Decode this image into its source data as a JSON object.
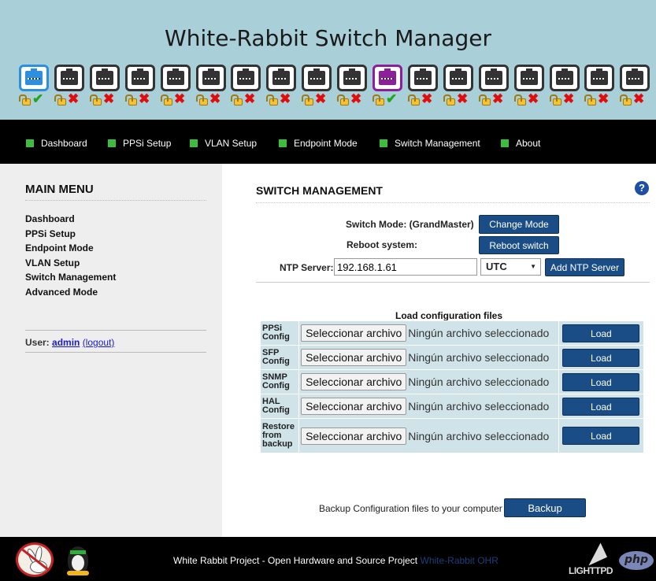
{
  "header": {
    "title": "White-Rabbit Switch Manager"
  },
  "ports": [
    {
      "name": "wr1",
      "color": "#2d8fe0",
      "locked": true,
      "link_ok": true
    },
    {
      "name": "wr2",
      "color": "#333333",
      "locked": false,
      "link_ok": false
    },
    {
      "name": "wr3",
      "color": "#333333",
      "locked": false,
      "link_ok": false
    },
    {
      "name": "wr4",
      "color": "#333333",
      "locked": false,
      "link_ok": false
    },
    {
      "name": "wr5",
      "color": "#333333",
      "locked": false,
      "link_ok": false
    },
    {
      "name": "wr6",
      "color": "#333333",
      "locked": false,
      "link_ok": false
    },
    {
      "name": "wr7",
      "color": "#333333",
      "locked": false,
      "link_ok": false
    },
    {
      "name": "wr8",
      "color": "#333333",
      "locked": false,
      "link_ok": false
    },
    {
      "name": "wr9",
      "color": "#333333",
      "locked": false,
      "link_ok": false
    },
    {
      "name": "wr10",
      "color": "#333333",
      "locked": false,
      "link_ok": false
    },
    {
      "name": "wr11",
      "color": "#8d1f9a",
      "locked": false,
      "link_ok": true
    },
    {
      "name": "wr12",
      "color": "#333333",
      "locked": false,
      "link_ok": false
    },
    {
      "name": "wr13",
      "color": "#333333",
      "locked": false,
      "link_ok": false
    },
    {
      "name": "wr14",
      "color": "#333333",
      "locked": false,
      "link_ok": false
    },
    {
      "name": "wr15",
      "color": "#333333",
      "locked": false,
      "link_ok": false
    },
    {
      "name": "wr16",
      "color": "#333333",
      "locked": false,
      "link_ok": false
    },
    {
      "name": "wr17",
      "color": "#333333",
      "locked": false,
      "link_ok": false
    },
    {
      "name": "wr18",
      "color": "#333333",
      "locked": false,
      "link_ok": false
    }
  ],
  "nav": {
    "items": [
      {
        "label": "Dashboard"
      },
      {
        "label": "PPSi Setup"
      },
      {
        "label": "VLAN Setup"
      },
      {
        "label": "Endpoint Mode"
      },
      {
        "label": "Switch Management"
      },
      {
        "label": "About"
      }
    ]
  },
  "sidebar": {
    "title": "MAIN MENU",
    "items": [
      {
        "label": "Dashboard"
      },
      {
        "label": "PPSi Setup"
      },
      {
        "label": "Endpoint Mode"
      },
      {
        "label": "VLAN Setup"
      },
      {
        "label": "Switch Management"
      },
      {
        "label": "Advanced Mode"
      }
    ],
    "user_label": "User:",
    "user_name": "admin",
    "logout_label": "(logout)"
  },
  "main": {
    "title": "SWITCH MANAGEMENT",
    "help_icon": "?",
    "switch_mode_label": "Switch Mode: (GrandMaster)",
    "change_mode_button": "Change Mode",
    "reboot_label": "Reboot system:",
    "reboot_button": "Reboot switch",
    "ntp_label": "NTP Server:",
    "ntp_value": "192.168.1.61",
    "timezone": "UTC",
    "add_ntp_button": "Add NTP Server",
    "load_title": "Load configuration files",
    "config_rows": [
      {
        "name": "PPSi Config"
      },
      {
        "name": "SFP Config"
      },
      {
        "name": "SNMP Config"
      },
      {
        "name": "HAL Config"
      },
      {
        "name": "Restore from backup"
      }
    ],
    "file_button": "Seleccionar archivo",
    "no_file_text": "Ningún archivo seleccionado",
    "load_button": "Load",
    "backup_text": "Backup Configuration files to your computer",
    "backup_button": "Backup"
  },
  "footer": {
    "text": "White Rabbit Project - Open Hardware and Source Project",
    "link": "White-Rabbit OHR",
    "lighttpd_label": "LIGHTTPD",
    "php_label": "php"
  }
}
